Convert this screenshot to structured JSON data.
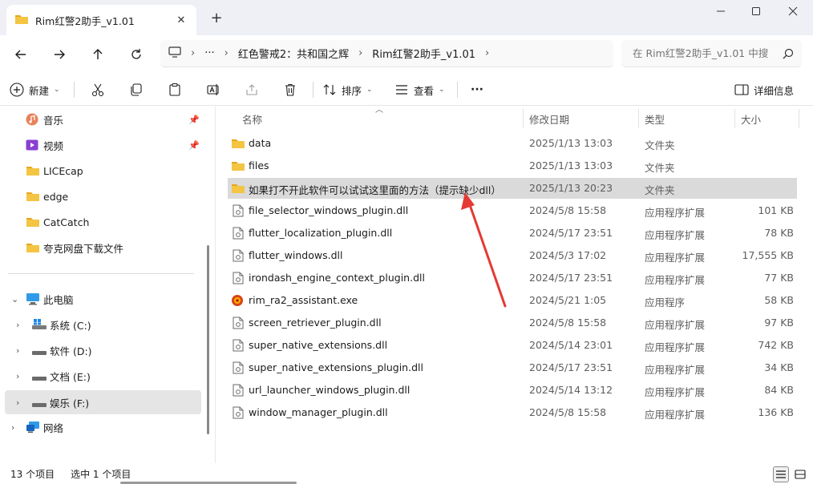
{
  "window": {
    "tab_title": "Rim红警2助手_v1.01",
    "tab_close": "✕",
    "new_tab": "+"
  },
  "address": {
    "more": "···",
    "crumbs": [
      "红色警戒2：共和国之辉",
      "Rim红警2助手_v1.01"
    ],
    "search_placeholder": "在 Rim红警2助手_v1.01 中搜"
  },
  "toolbar": {
    "new_label": "新建",
    "sort_label": "排序",
    "view_label": "查看",
    "more": "···",
    "details_label": "详细信息"
  },
  "sidebar": {
    "quick": [
      {
        "label": "音乐",
        "icon": "music-icon",
        "pinned": true
      },
      {
        "label": "视频",
        "icon": "video-icon",
        "pinned": true
      },
      {
        "label": "LICEcap",
        "icon": "folder-icon",
        "pinned": false
      },
      {
        "label": "edge",
        "icon": "folder-icon",
        "pinned": false
      },
      {
        "label": "CatCatch",
        "icon": "folder-icon",
        "pinned": false
      },
      {
        "label": "夸克网盘下载文件",
        "icon": "folder-icon",
        "pinned": false
      }
    ],
    "this_pc": "此电脑",
    "drives": [
      {
        "label": "系统 (C:)",
        "icon": "windows-drive-icon",
        "selected": false
      },
      {
        "label": "软件 (D:)",
        "icon": "drive-icon",
        "selected": false
      },
      {
        "label": "文档 (E:)",
        "icon": "drive-icon",
        "selected": false
      },
      {
        "label": "娱乐 (F:)",
        "icon": "drive-icon",
        "selected": true
      }
    ],
    "network": "网络"
  },
  "columns": {
    "name": "名称",
    "date": "修改日期",
    "type": "类型",
    "size": "大小"
  },
  "files": [
    {
      "name": "data",
      "date": "2025/1/13 13:03",
      "type": "文件夹",
      "size": "",
      "kind": "folder"
    },
    {
      "name": "files",
      "date": "2025/1/13 13:03",
      "type": "文件夹",
      "size": "",
      "kind": "folder"
    },
    {
      "name": "如果打不开此软件可以试试这里面的方法（提示缺少dll）",
      "date": "2025/1/13 20:23",
      "type": "文件夹",
      "size": "",
      "kind": "folder",
      "selected": true
    },
    {
      "name": "file_selector_windows_plugin.dll",
      "date": "2024/5/8 15:58",
      "type": "应用程序扩展",
      "size": "101 KB",
      "kind": "dll"
    },
    {
      "name": "flutter_localization_plugin.dll",
      "date": "2024/5/17 23:51",
      "type": "应用程序扩展",
      "size": "78 KB",
      "kind": "dll"
    },
    {
      "name": "flutter_windows.dll",
      "date": "2024/5/3 17:02",
      "type": "应用程序扩展",
      "size": "17,555 KB",
      "kind": "dll"
    },
    {
      "name": "irondash_engine_context_plugin.dll",
      "date": "2024/5/17 23:51",
      "type": "应用程序扩展",
      "size": "77 KB",
      "kind": "dll"
    },
    {
      "name": "rim_ra2_assistant.exe",
      "date": "2024/5/21 1:05",
      "type": "应用程序",
      "size": "58 KB",
      "kind": "exe"
    },
    {
      "name": "screen_retriever_plugin.dll",
      "date": "2024/5/8 15:58",
      "type": "应用程序扩展",
      "size": "97 KB",
      "kind": "dll"
    },
    {
      "name": "super_native_extensions.dll",
      "date": "2024/5/14 23:01",
      "type": "应用程序扩展",
      "size": "742 KB",
      "kind": "dll"
    },
    {
      "name": "super_native_extensions_plugin.dll",
      "date": "2024/5/17 23:51",
      "type": "应用程序扩展",
      "size": "34 KB",
      "kind": "dll"
    },
    {
      "name": "url_launcher_windows_plugin.dll",
      "date": "2024/5/14 13:12",
      "type": "应用程序扩展",
      "size": "84 KB",
      "kind": "dll"
    },
    {
      "name": "window_manager_plugin.dll",
      "date": "2024/5/8 15:58",
      "type": "应用程序扩展",
      "size": "136 KB",
      "kind": "dll"
    }
  ],
  "status": {
    "count": "13 个项目",
    "selected": "选中 1 个项目"
  },
  "colors": {
    "folder": "#f4c542",
    "folder_dark": "#e3a81f",
    "accent": "#0067c0",
    "arrow": "#e53935"
  }
}
